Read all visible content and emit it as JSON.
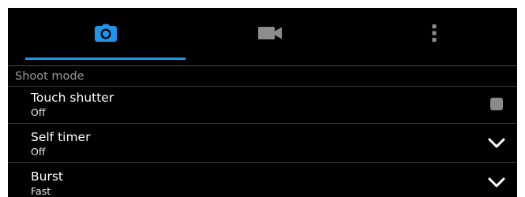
{
  "tabs": [
    {
      "icon": "camera-icon",
      "selected": true
    },
    {
      "icon": "video-camera-icon",
      "selected": false
    },
    {
      "icon": "more-vertical-icon",
      "selected": false
    }
  ],
  "accent_color": "#1e95e8",
  "section_header": "Shoot mode",
  "items": [
    {
      "title": "Touch shutter",
      "value": "Off",
      "control": "checkbox",
      "checked": false
    },
    {
      "title": "Self timer",
      "value": "Off",
      "control": "dropdown"
    },
    {
      "title": "Burst",
      "value": "Fast",
      "control": "dropdown"
    }
  ]
}
